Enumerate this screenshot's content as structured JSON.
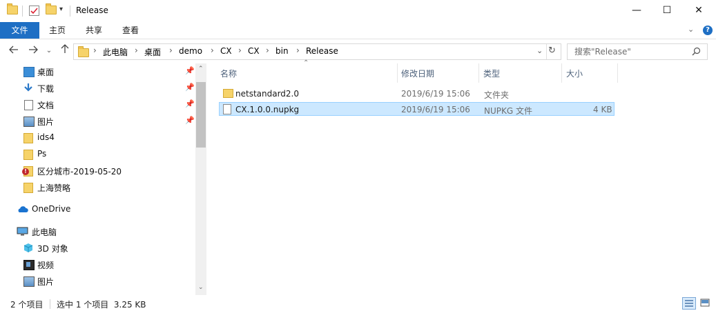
{
  "window": {
    "title": "Release"
  },
  "window_controls": {
    "minimize": "—",
    "maximize": "☐",
    "close": "✕"
  },
  "ribbon": {
    "tabs": [
      {
        "label": "文件"
      },
      {
        "label": "主页"
      },
      {
        "label": "共享"
      },
      {
        "label": "查看"
      }
    ]
  },
  "address": {
    "breadcrumbs": [
      "此电脑",
      "桌面",
      "demo",
      "CX",
      "CX",
      "bin",
      "Release"
    ]
  },
  "search": {
    "placeholder": "搜索\"Release\""
  },
  "nav": {
    "quick_access": [
      {
        "label": "桌面",
        "icon": "desktop-icon",
        "pinned": true
      },
      {
        "label": "下载",
        "icon": "download-icon",
        "pinned": true
      },
      {
        "label": "文档",
        "icon": "document-icon",
        "pinned": true
      },
      {
        "label": "图片",
        "icon": "picture-icon",
        "pinned": true
      },
      {
        "label": "ids4",
        "icon": "folder-icon",
        "pinned": false
      },
      {
        "label": "Ps",
        "icon": "folder-icon",
        "pinned": false
      },
      {
        "label": "区分城市-2019-05-20",
        "icon": "folder-error-icon",
        "pinned": false
      },
      {
        "label": "上海赞略",
        "icon": "folder-icon",
        "pinned": false
      }
    ],
    "onedrive": {
      "label": "OneDrive",
      "icon": "onedrive-icon"
    },
    "this_pc": {
      "label": "此电脑",
      "icon": "computer-icon"
    },
    "pc_items": [
      {
        "label": "3D 对象",
        "icon": "cube-icon"
      },
      {
        "label": "视频",
        "icon": "video-icon"
      },
      {
        "label": "图片",
        "icon": "picture-icon"
      }
    ]
  },
  "columns": {
    "name": "名称",
    "modified": "修改日期",
    "type": "类型",
    "size": "大小"
  },
  "files": [
    {
      "name": "netstandard2.0",
      "modified": "2019/6/19 15:06",
      "type": "文件夹",
      "size": "",
      "icon": "folder-icon",
      "selected": false
    },
    {
      "name": "CX.1.0.0.nupkg",
      "modified": "2019/6/19 15:06",
      "type": "NUPKG 文件",
      "size": "4 KB",
      "icon": "file-icon",
      "selected": true
    }
  ],
  "status": {
    "item_count": "2 个项目",
    "selection": "选中 1 个项目  3.25 KB"
  },
  "colors": {
    "accent": "#1e6fc4",
    "selection": "#cce8ff",
    "selection_border": "#99d1ff"
  }
}
